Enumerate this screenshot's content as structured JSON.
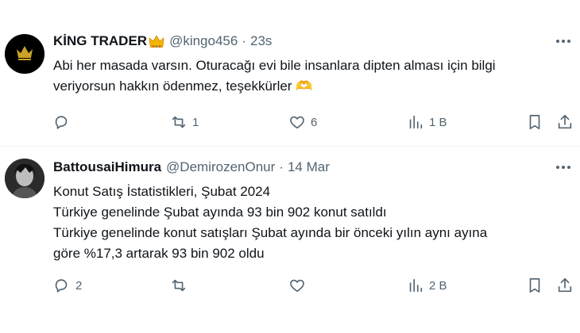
{
  "tweets": [
    {
      "name": "KİNG TRADER",
      "name_emoji": "crown-emoji",
      "handle": "@kingo456",
      "separator": "·",
      "time": "23s",
      "avatar": {
        "text": "King Trader",
        "icon": "crown-logo"
      },
      "lines": [
        "Abi her masada varsın. Oturacağı evi bile insanlara dipten alması için bilgi",
        "veriyorsun hakkın ödenmez, teşekkürler 🫶"
      ],
      "replies": "",
      "reposts": "1",
      "likes": "6",
      "views": "1 B"
    },
    {
      "name": "BattousaiHimura",
      "handle": "@DemirozenOnur",
      "separator": "·",
      "time": "14 Mar",
      "lines": [
        "Konut Satış İstatistikleri, Şubat 2024",
        "Türkiye genelinde Şubat ayında 93 bin 902 konut satıldı",
        "Türkiye genelinde konut satışları Şubat ayında bir önceki yılın aynı ayına",
        "göre %17,3 artarak 93 bin 902 oldu"
      ],
      "replies": "2",
      "reposts": "",
      "likes": "",
      "views": "2 B"
    }
  ],
  "colors": {
    "text": "#0f1419",
    "muted": "#536471",
    "border": "#eff3f4",
    "crown": "#f4b400"
  }
}
